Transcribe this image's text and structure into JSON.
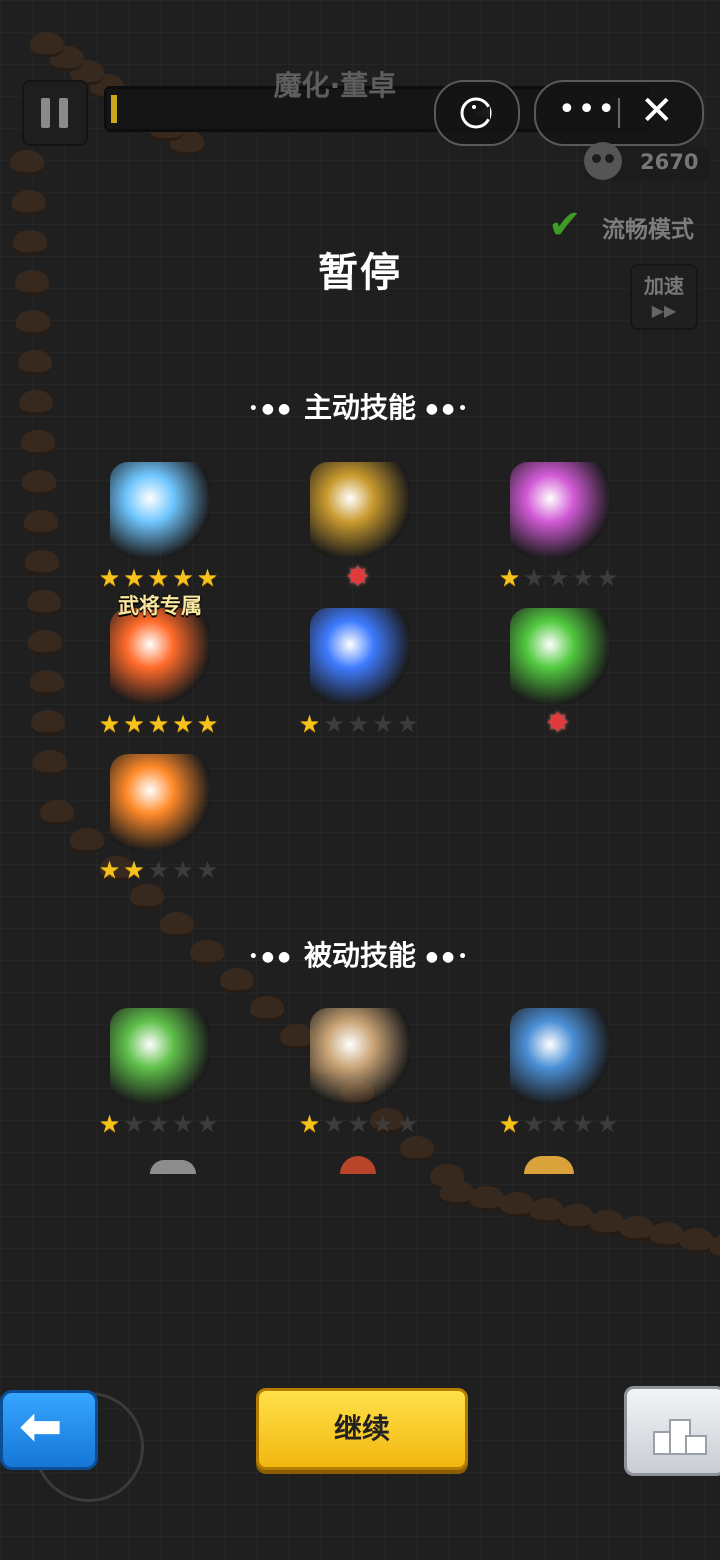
{
  "hud": {
    "boss_name": "魔化·董卓",
    "kill_count": "2670",
    "smooth_mode_label": "流畅模式",
    "speed_label": "加速",
    "more_glyph": "•••",
    "close_glyph": "✕"
  },
  "pause_title": "暂停",
  "active_section": {
    "title": "主动技能",
    "bullets_left": "•●●",
    "bullets_right": "●●•"
  },
  "passive_section": {
    "title": "被动技能",
    "bullets_left": "•●●",
    "bullets_right": "●●•"
  },
  "active_skills": [
    {
      "icon": "ice-sword-icon",
      "stars": 5,
      "max": 5,
      "color": "#6fc6ff"
    },
    {
      "icon": "golden-crossbow-icon",
      "stars": 0,
      "max": 5,
      "red_star": true,
      "color": "#c99a2e"
    },
    {
      "icon": "guqin-music-icon",
      "stars": 1,
      "max": 5,
      "color": "#d25ad6"
    },
    {
      "icon": "flame-blade-icon",
      "stars": 5,
      "max": 5,
      "exclusive_label": "武将专属",
      "color": "#ff6a2a"
    },
    {
      "icon": "blue-shuriken-icon",
      "stars": 1,
      "max": 5,
      "color": "#3f7bff"
    },
    {
      "icon": "green-drum-icon",
      "stars": 0,
      "max": 5,
      "red_star": true,
      "color": "#52c940"
    },
    {
      "icon": "fire-hammer-icon",
      "stars": 2,
      "max": 5,
      "color": "#ff8a2a"
    }
  ],
  "passive_skills": [
    {
      "icon": "jade-pendant-icon",
      "stars": 1,
      "max": 5,
      "color": "#5fc04a"
    },
    {
      "icon": "ginseng-root-icon",
      "stars": 1,
      "max": 5,
      "color": "#c9a476"
    },
    {
      "icon": "armor-vest-icon",
      "stars": 1,
      "max": 5,
      "color": "#4b8fd6"
    }
  ],
  "buttons": {
    "continue": "继续",
    "back_glyph": "⬅"
  },
  "colors": {
    "star_on": "#f6c21c",
    "star_off": "#3c3c3c",
    "continue_bg": "#f7c624",
    "back_bg": "#2a8eea"
  }
}
